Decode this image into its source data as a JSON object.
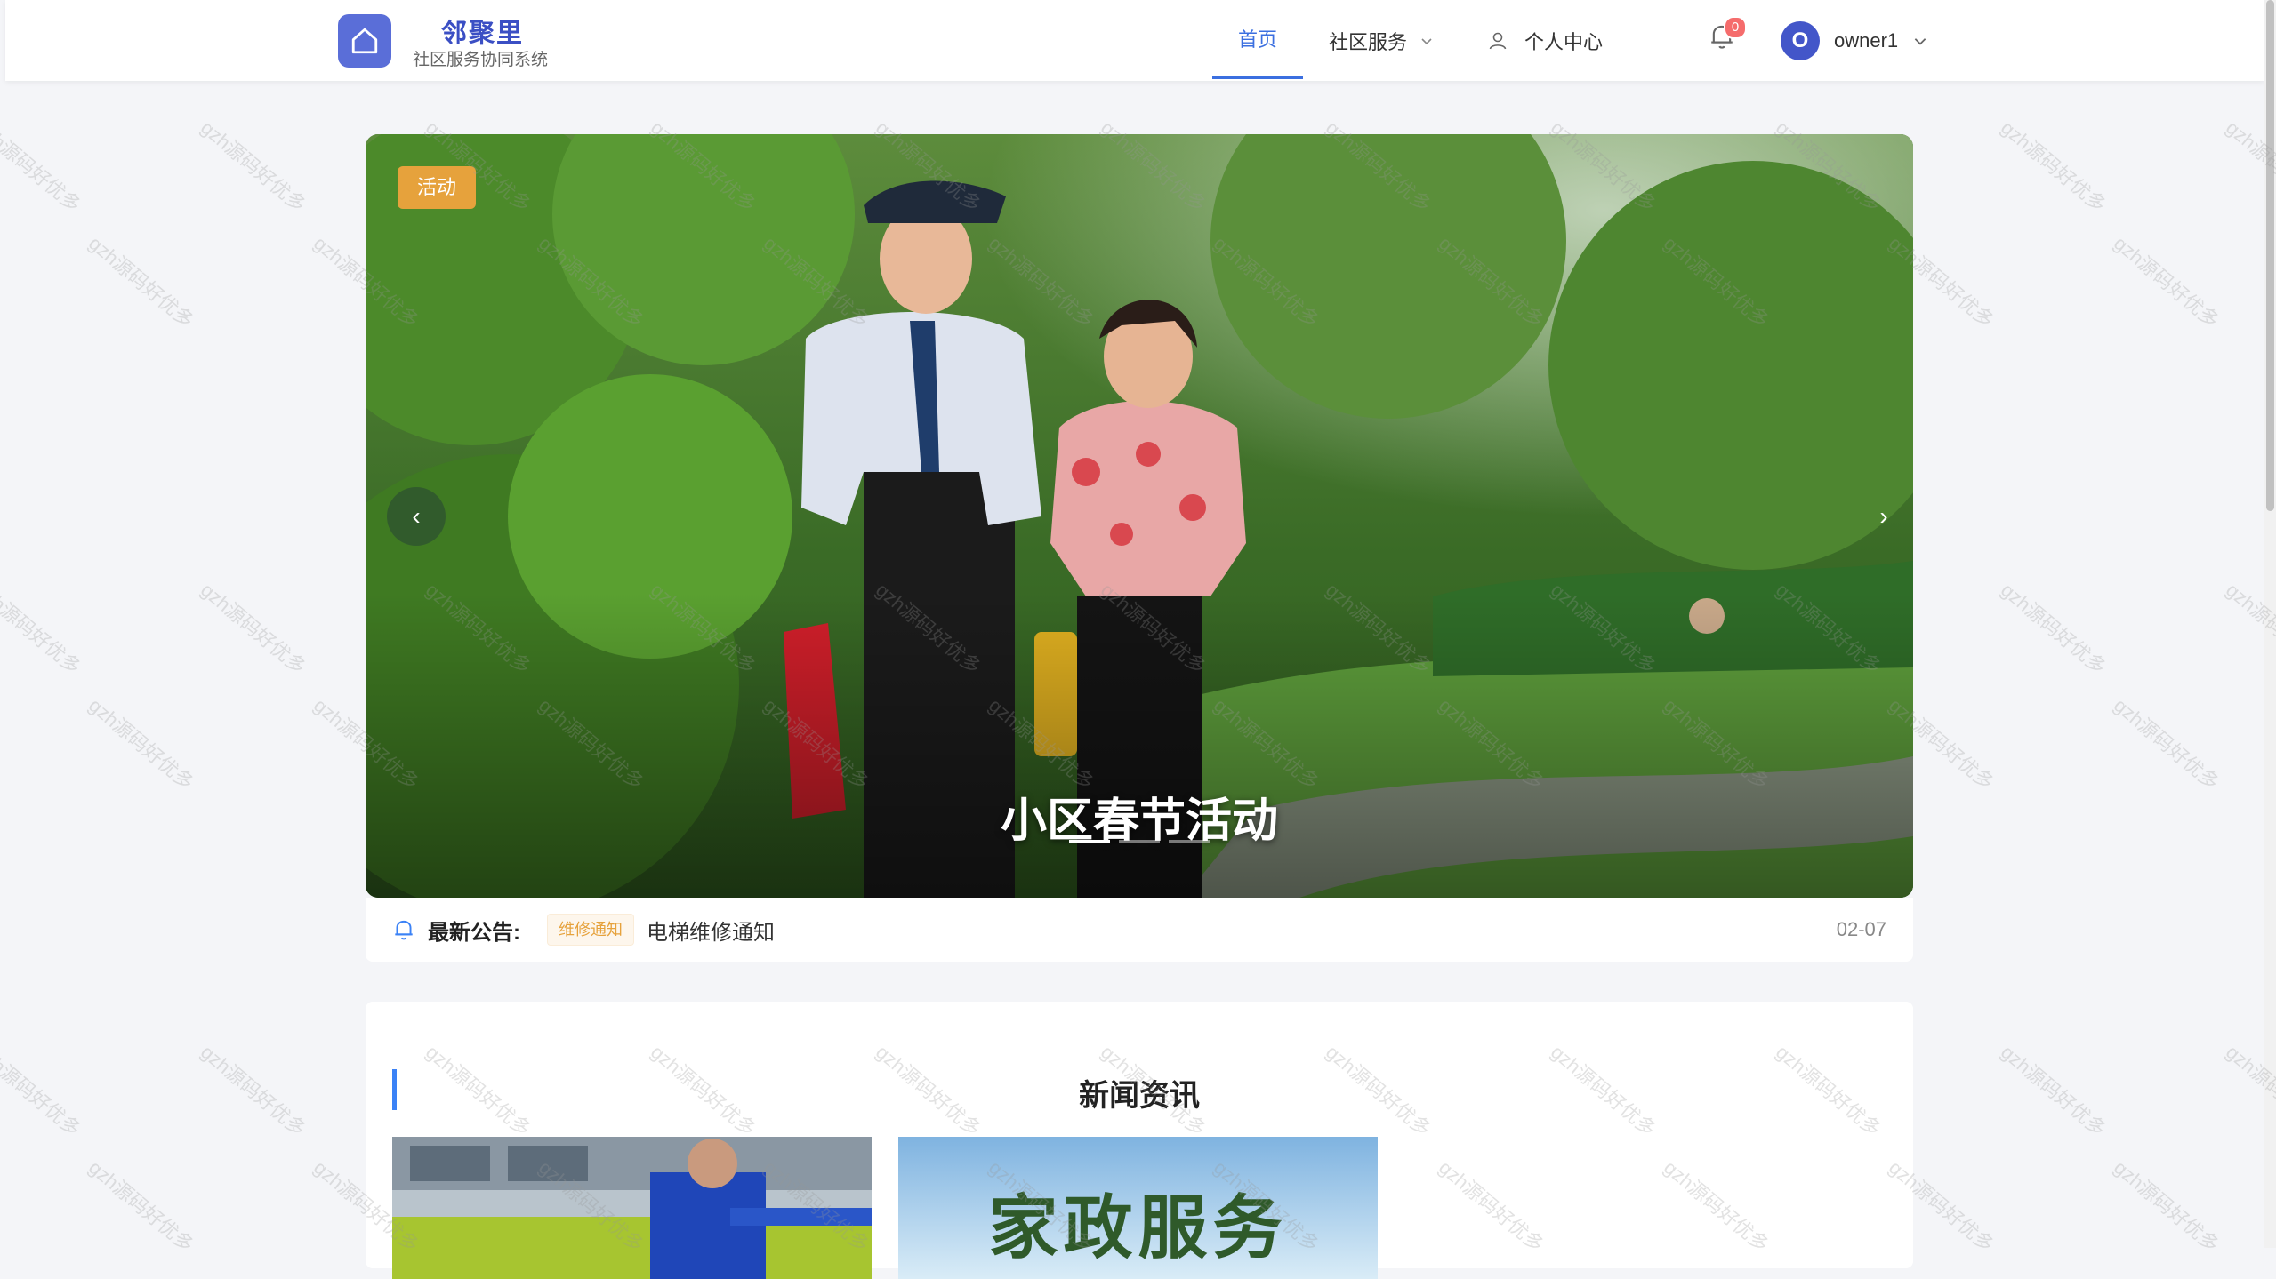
{
  "header": {
    "brand_name": "邻聚里",
    "brand_sub": "社区服务协同系统",
    "nav": {
      "home": "首页",
      "services": "社区服务",
      "profile": "个人中心"
    },
    "notification_count": "0",
    "user": {
      "avatar_letter": "O",
      "name": "owner1"
    }
  },
  "carousel": {
    "tag": "活动",
    "title": "小区春节活动",
    "prev_icon": "‹",
    "next_icon": "›",
    "slide_count": 3,
    "active_index": 0
  },
  "notice": {
    "label": "最新公告:",
    "tag": "维修通知",
    "text": "电梯维修通知",
    "date": "02-07"
  },
  "news": {
    "title": "新闻资讯",
    "card2_banner": "家政服务"
  },
  "watermark": "gzh源码好优多",
  "colors": {
    "accent": "#3b6fe0",
    "brand": "#5a6ed8",
    "tag_orange": "#e6a23c",
    "badge_red": "#f56c6c"
  }
}
